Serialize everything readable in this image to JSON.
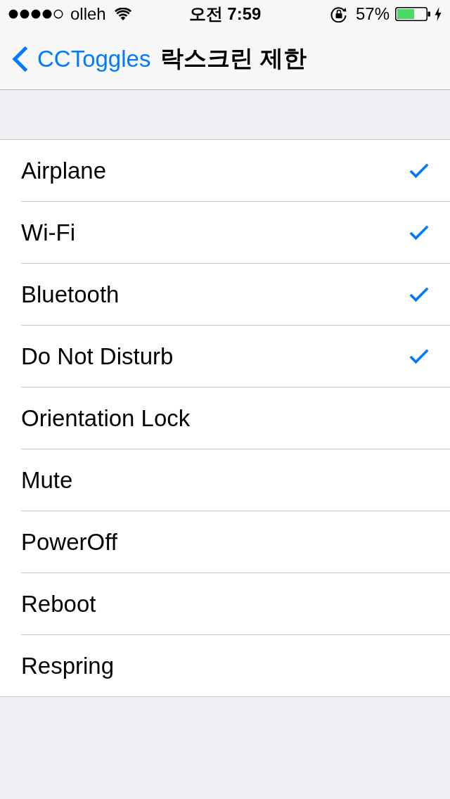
{
  "status_bar": {
    "carrier": "olleh",
    "time": "오전 7:59",
    "battery": "57%"
  },
  "nav_bar": {
    "back": "CCToggles",
    "title": "락스크린 제한"
  },
  "rows": [
    {
      "label": "Airplane",
      "checked": true
    },
    {
      "label": "Wi-Fi",
      "checked": true
    },
    {
      "label": "Bluetooth",
      "checked": true
    },
    {
      "label": "Do Not Disturb",
      "checked": true
    },
    {
      "label": "Orientation Lock",
      "checked": false
    },
    {
      "label": "Mute",
      "checked": false
    },
    {
      "label": "PowerOff",
      "checked": false
    },
    {
      "label": "Reboot",
      "checked": false
    },
    {
      "label": "Respring",
      "checked": false
    }
  ]
}
